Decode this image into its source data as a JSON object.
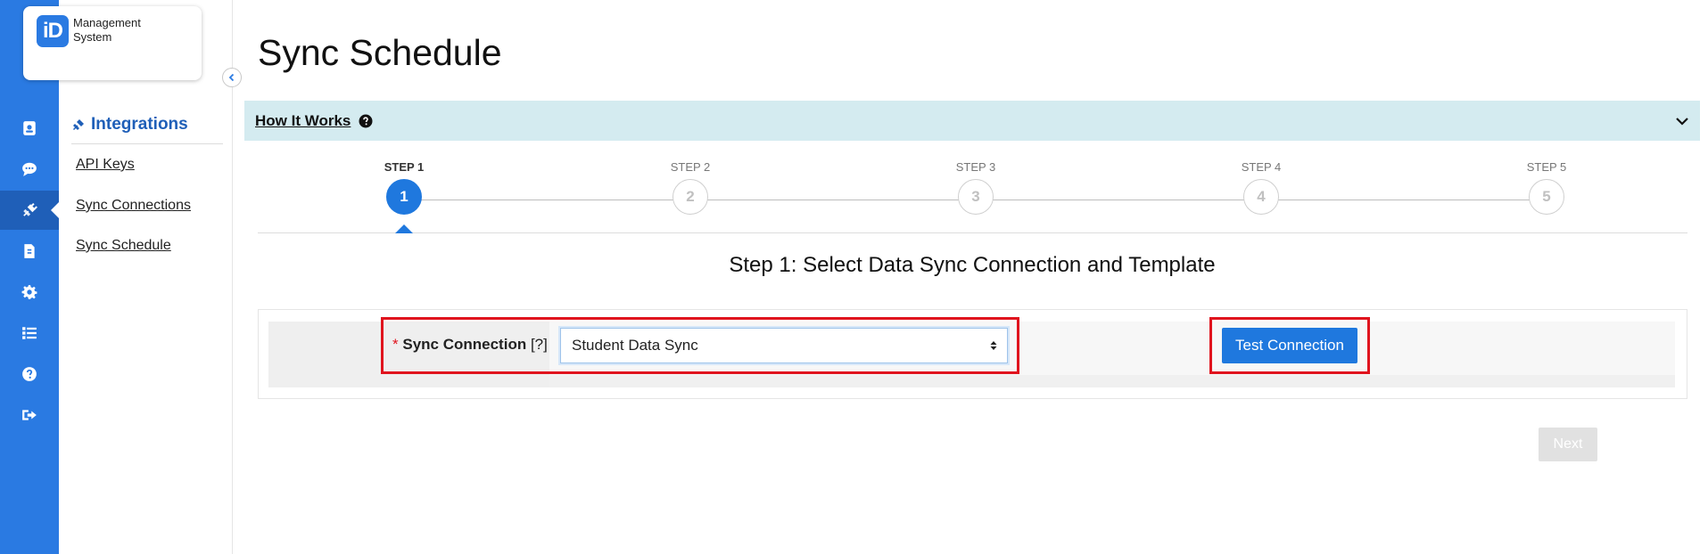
{
  "app": {
    "logo_mark": "iD",
    "logo_text": "Management System"
  },
  "rail": {
    "items": [
      {
        "icon": "badge-icon"
      },
      {
        "icon": "chat-icon"
      },
      {
        "icon": "plug-icon",
        "active": true
      },
      {
        "icon": "document-icon"
      },
      {
        "icon": "gear-icon"
      },
      {
        "icon": "list-icon"
      },
      {
        "icon": "help-icon"
      },
      {
        "icon": "logout-icon"
      }
    ]
  },
  "subnav": {
    "title": "Integrations",
    "links": [
      "API Keys",
      "Sync Connections",
      "Sync Schedule"
    ]
  },
  "page": {
    "title": "Sync Schedule",
    "how_it_works": "How It Works"
  },
  "stepper": {
    "steps": [
      {
        "label": "STEP 1",
        "number": "1",
        "active": true
      },
      {
        "label": "STEP 2",
        "number": "2"
      },
      {
        "label": "STEP 3",
        "number": "3"
      },
      {
        "label": "STEP 4",
        "number": "4"
      },
      {
        "label": "STEP 5",
        "number": "5"
      }
    ],
    "heading": "Step 1: Select Data Sync Connection and Template"
  },
  "form": {
    "required_mark": "*",
    "field_label": "Sync Connection",
    "field_hint": "[?]",
    "select_value": "Student Data Sync",
    "test_button": "Test Connection"
  },
  "footer": {
    "next_button": "Next"
  },
  "colors": {
    "rail": "#2a7ae2",
    "accent": "#1f78de",
    "banner": "#d4ebf0",
    "highlight": "#e0141e"
  }
}
